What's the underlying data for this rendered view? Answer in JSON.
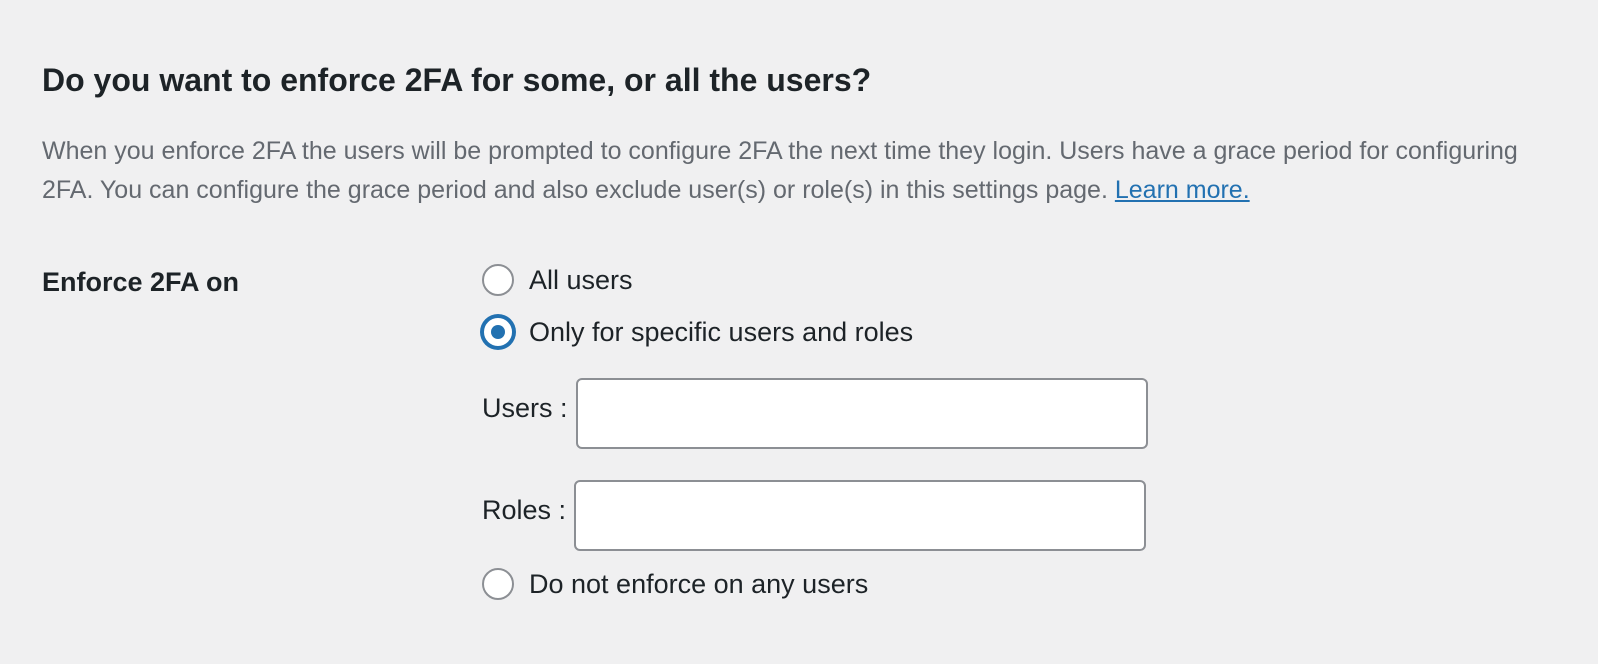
{
  "section": {
    "heading": "Do you want to enforce 2FA for some, or all the users?",
    "description": "When you enforce 2FA the users will be prompted to configure 2FA the next time they login. Users have a grace period for configuring 2FA. You can configure the grace period and also exclude user(s) or role(s) in this settings page.",
    "learn_more_link": "Learn more."
  },
  "enforce": {
    "label": "Enforce 2FA on",
    "options": [
      {
        "label": "All users",
        "checked": false
      },
      {
        "label": "Only for specific users and roles",
        "checked": true
      },
      {
        "label": "Do not enforce on any users",
        "checked": false
      }
    ],
    "users_label": "Users :",
    "users_value": "",
    "users_placeholder": "",
    "roles_label": "Roles :",
    "roles_value": "",
    "roles_placeholder": ""
  },
  "colors": {
    "background": "#f0f0f1",
    "accent": "#2271b1",
    "text": "#1d2327",
    "muted_text": "#646970",
    "border": "#8c8f94"
  }
}
